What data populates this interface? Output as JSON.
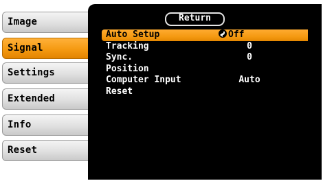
{
  "sidebar": {
    "items": [
      {
        "label": "Image"
      },
      {
        "label": "Signal"
      },
      {
        "label": "Settings"
      },
      {
        "label": "Extended"
      },
      {
        "label": "Info"
      },
      {
        "label": "Reset"
      }
    ],
    "active_index": 1
  },
  "panel": {
    "return_label": "Return",
    "rows": [
      {
        "label": "Auto Setup",
        "value": "Off",
        "selected": true
      },
      {
        "label": "Tracking",
        "value": "0"
      },
      {
        "label": "Sync.",
        "value": "0"
      },
      {
        "label": "Position",
        "value": ""
      },
      {
        "label": "Computer Input",
        "value": "Auto"
      },
      {
        "label": "Reset",
        "value": ""
      }
    ]
  },
  "colors": {
    "accent": "#f59a12",
    "panel_bg": "#000000",
    "tab_bg": "#e0e0e0"
  }
}
